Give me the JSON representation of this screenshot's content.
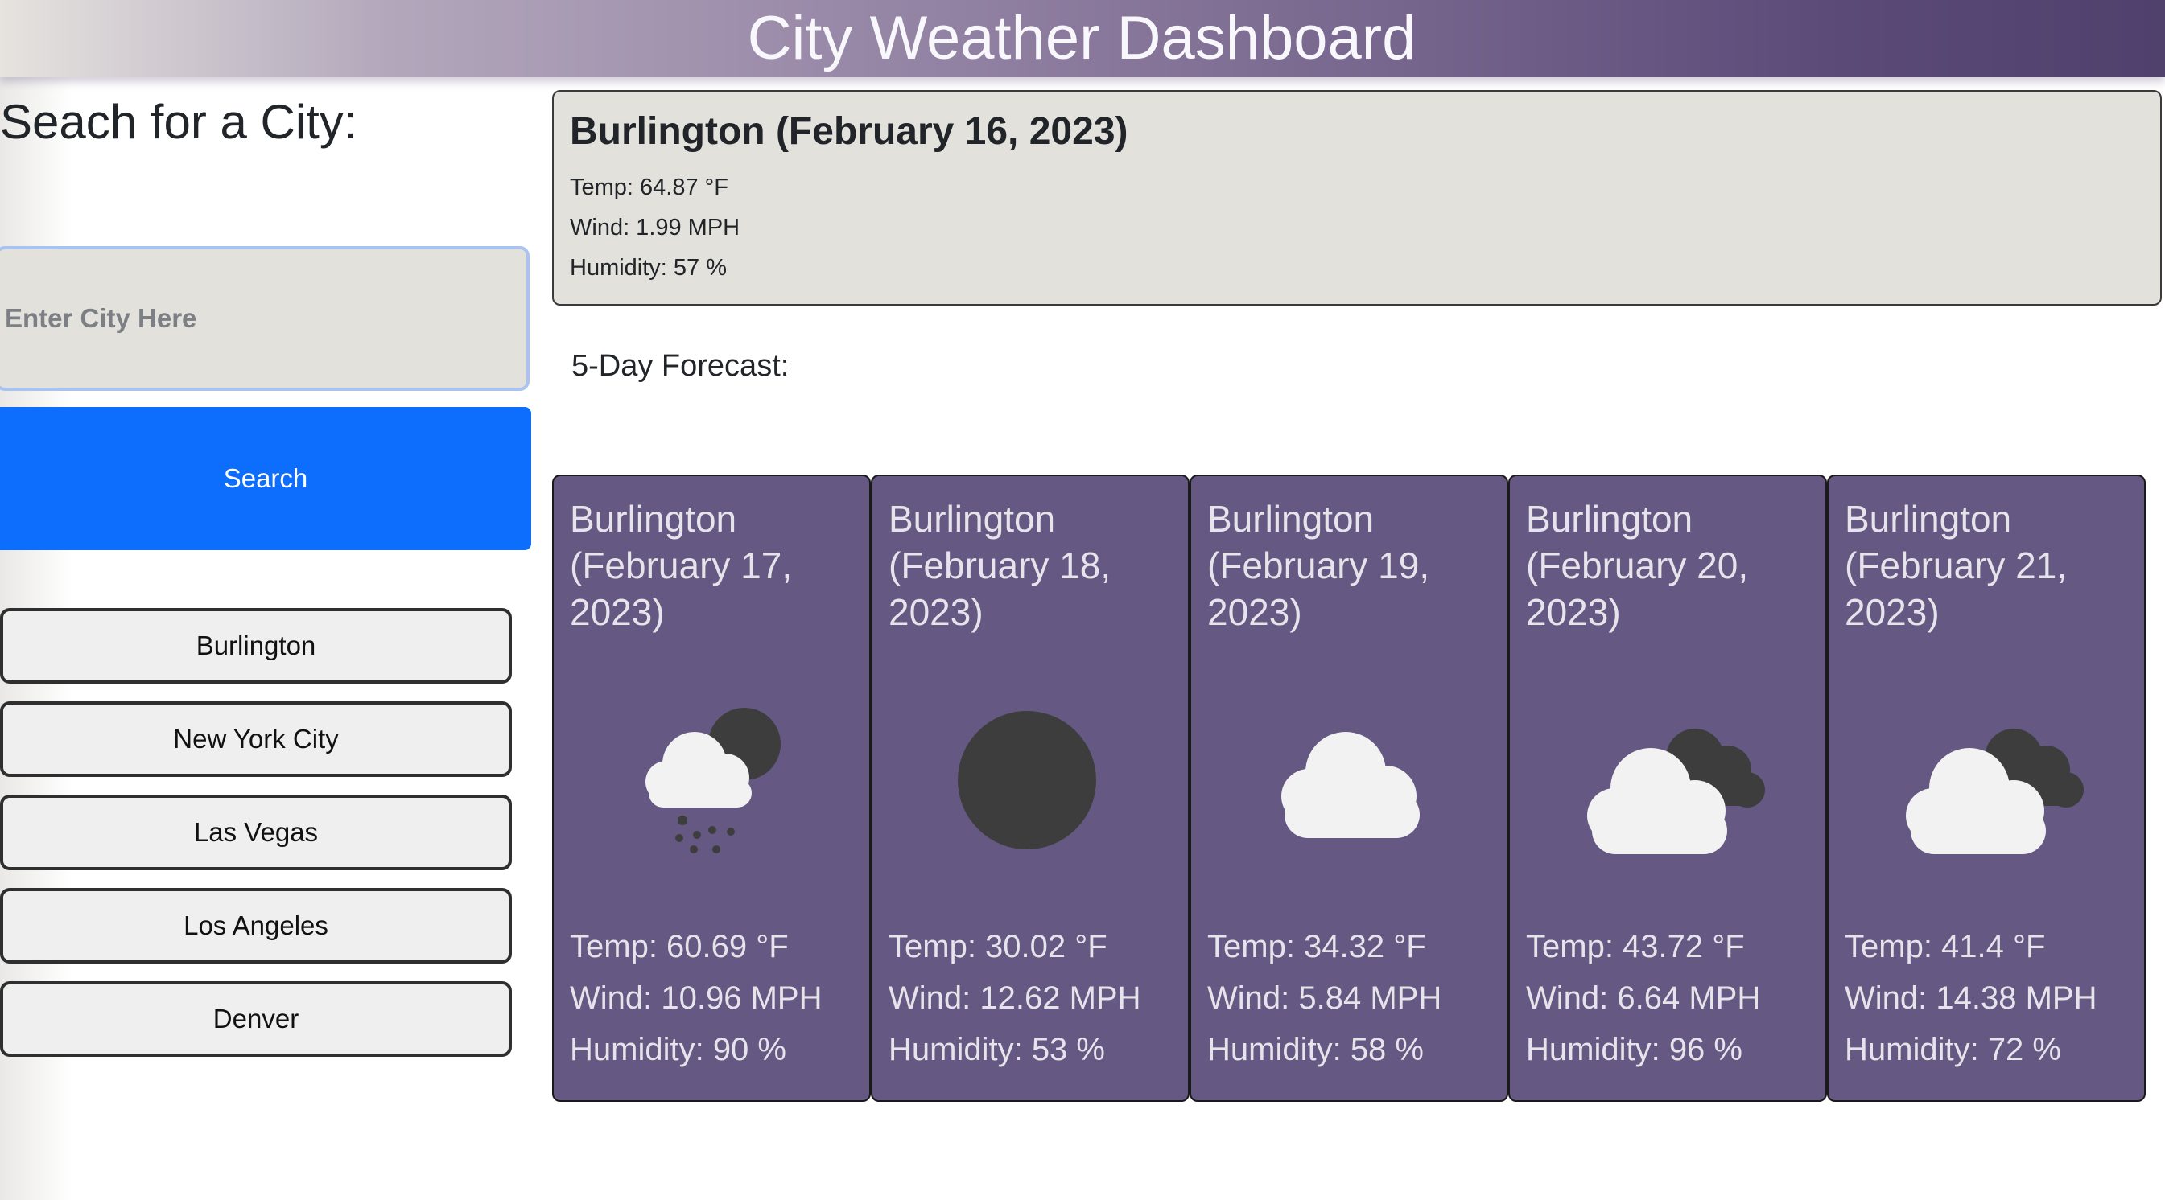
{
  "header": {
    "title": "City Weather Dashboard"
  },
  "search": {
    "heading": "Seach for a City:",
    "placeholder": "Enter City Here",
    "button_label": "Search"
  },
  "history": [
    {
      "label": "Burlington"
    },
    {
      "label": "New York City"
    },
    {
      "label": "Las Vegas"
    },
    {
      "label": "Los Angeles"
    },
    {
      "label": "Denver"
    }
  ],
  "current": {
    "title": "Burlington (February 16, 2023)",
    "temp": "Temp: 64.87 °F",
    "wind": "Wind: 1.99 MPH",
    "humidity": "Humidity: 57 %"
  },
  "forecast": {
    "label": "5-Day Forecast:",
    "days": [
      {
        "date": "Burlington (February 17, 2023)",
        "icon": "rain-cloud-moon-icon",
        "temp": "Temp: 60.69 °F",
        "wind": "Wind: 10.96 MPH",
        "humidity": "Humidity: 90 %"
      },
      {
        "date": "Burlington (February 18, 2023)",
        "icon": "clear-night-icon",
        "temp": "Temp: 30.02 °F",
        "wind": "Wind: 12.62 MPH",
        "humidity": "Humidity: 53 %"
      },
      {
        "date": "Burlington (February 19, 2023)",
        "icon": "cloud-icon",
        "temp": "Temp: 34.32 °F",
        "wind": "Wind: 5.84 MPH",
        "humidity": "Humidity: 58 %"
      },
      {
        "date": "Burlington (February 20, 2023)",
        "icon": "broken-clouds-icon",
        "temp": "Temp: 43.72 °F",
        "wind": "Wind: 6.64 MPH",
        "humidity": "Humidity: 96 %"
      },
      {
        "date": "Burlington (February 21, 2023)",
        "icon": "broken-clouds-icon",
        "temp": "Temp: 41.4 °F",
        "wind": "Wind: 14.38 MPH",
        "humidity": "Humidity: 72 %"
      }
    ]
  },
  "colors": {
    "header_start": "#e6e3df",
    "header_end": "#4f406c",
    "search_button": "#0d6efd",
    "card_background": "#655883",
    "current_background": "#e3e1dc"
  }
}
